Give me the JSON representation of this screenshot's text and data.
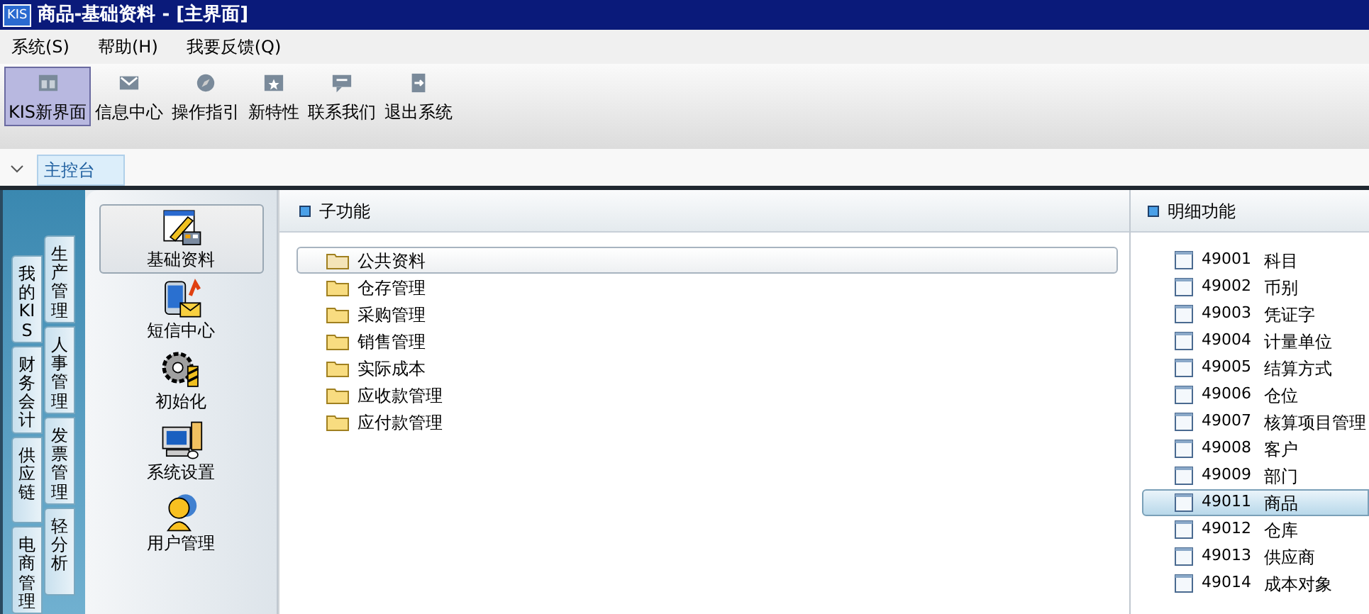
{
  "window": {
    "logo": "KIS",
    "title": "商品-基础资料 - [主界面]"
  },
  "menu": [
    "系统(S)",
    "帮助(H)",
    "我要反馈(Q)"
  ],
  "toolbar": [
    {
      "label": "KIS新界面",
      "kind": "layout",
      "selected": true
    },
    {
      "label": "信息中心",
      "kind": "mail",
      "selected": false
    },
    {
      "label": "操作指引",
      "kind": "compass",
      "selected": false
    },
    {
      "label": "新特性",
      "kind": "star",
      "selected": false
    },
    {
      "label": "联系我们",
      "kind": "chat",
      "selected": false
    },
    {
      "label": "退出系统",
      "kind": "exit",
      "selected": false
    }
  ],
  "doc_tabs": [
    {
      "label": "主控台",
      "selected": true
    }
  ],
  "side_tabs": [
    [
      {
        "label": "我的KIS",
        "selected": false
      },
      {
        "label": "财务会计",
        "selected": false
      },
      {
        "label": "供应链",
        "selected": false
      },
      {
        "label": "电商管理",
        "selected": false
      }
    ],
    [
      {
        "label": "生产管理",
        "selected": false
      },
      {
        "label": "人事管理",
        "selected": false
      },
      {
        "label": "发票管理",
        "selected": false
      },
      {
        "label": "轻分析",
        "selected": false
      }
    ]
  ],
  "modules": [
    {
      "label": "基础资料",
      "kind": "base",
      "selected": true
    },
    {
      "label": "短信中心",
      "kind": "sms",
      "selected": false
    },
    {
      "label": "初始化",
      "kind": "init",
      "selected": false
    },
    {
      "label": "系统设置",
      "kind": "settings",
      "selected": false
    },
    {
      "label": "用户管理",
      "kind": "user",
      "selected": false
    }
  ],
  "sub_functions": {
    "title": "子功能",
    "items": [
      {
        "label": "公共资料",
        "selected": true
      },
      {
        "label": "仓存管理",
        "selected": false
      },
      {
        "label": "采购管理",
        "selected": false
      },
      {
        "label": "销售管理",
        "selected": false
      },
      {
        "label": "实际成本",
        "selected": false
      },
      {
        "label": "应收款管理",
        "selected": false
      },
      {
        "label": "应付款管理",
        "selected": false
      }
    ]
  },
  "details": {
    "title": "明细功能",
    "items": [
      {
        "code": "49001",
        "label": "科目",
        "selected": false
      },
      {
        "code": "49002",
        "label": "币别",
        "selected": false
      },
      {
        "code": "49003",
        "label": "凭证字",
        "selected": false
      },
      {
        "code": "49004",
        "label": "计量单位",
        "selected": false
      },
      {
        "code": "49005",
        "label": "结算方式",
        "selected": false
      },
      {
        "code": "49006",
        "label": "仓位",
        "selected": false
      },
      {
        "code": "49007",
        "label": "核算项目管理",
        "selected": false
      },
      {
        "code": "49008",
        "label": "客户",
        "selected": false
      },
      {
        "code": "49009",
        "label": "部门",
        "selected": false
      },
      {
        "code": "49011",
        "label": "商品",
        "selected": true
      },
      {
        "code": "49012",
        "label": "仓库",
        "selected": false
      },
      {
        "code": "49013",
        "label": "供应商",
        "selected": false
      },
      {
        "code": "49014",
        "label": "成本对象",
        "selected": false
      }
    ]
  }
}
